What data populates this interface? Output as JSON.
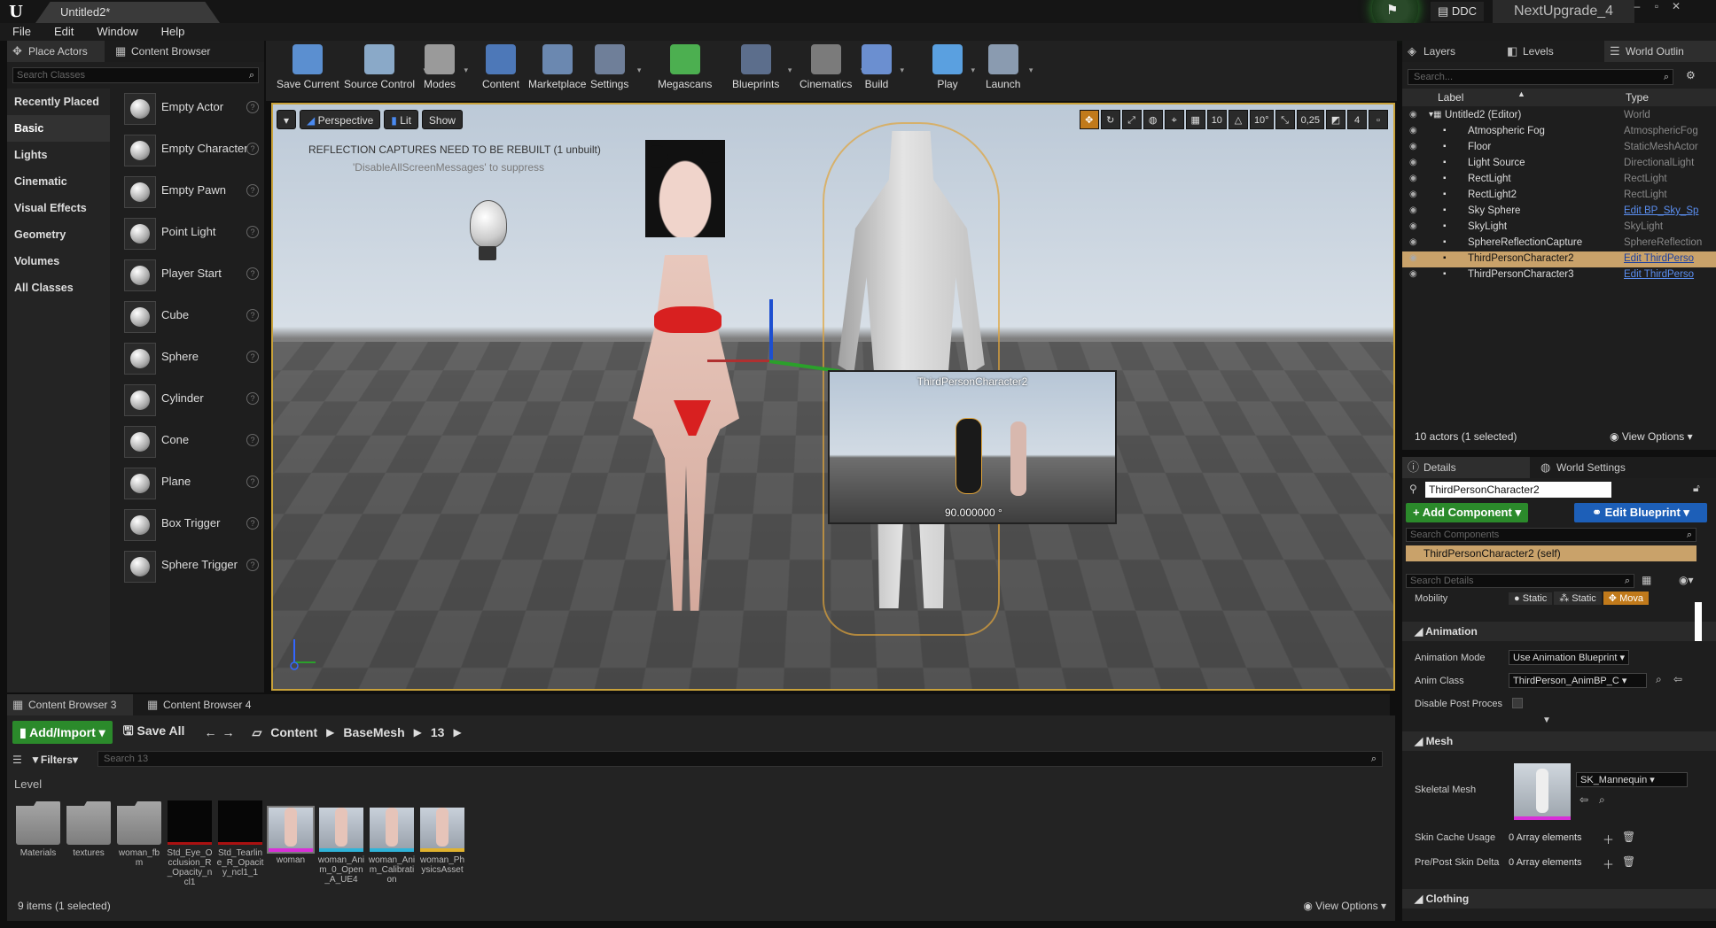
{
  "window": {
    "doc_tab": "Untitled2*",
    "ddc": "DDC",
    "project": "NextUpgrade_4"
  },
  "menu": [
    "File",
    "Edit",
    "Window",
    "Help"
  ],
  "left_tabs": {
    "place_actors": "Place Actors",
    "content_browser": "Content Browser"
  },
  "place_actors": {
    "search_placeholder": "Search Classes",
    "categories": [
      "Recently Placed",
      "Basic",
      "Lights",
      "Cinematic",
      "Visual Effects",
      "Geometry",
      "Volumes",
      "All Classes"
    ],
    "active_category": "Basic",
    "items": [
      "Empty Actor",
      "Empty Character",
      "Empty Pawn",
      "Point Light",
      "Player Start",
      "Cube",
      "Sphere",
      "Cylinder",
      "Cone",
      "Plane",
      "Box Trigger",
      "Sphere Trigger"
    ]
  },
  "toolbar": [
    {
      "label": "Save Current",
      "icon": "save-icon",
      "dd": false
    },
    {
      "label": "Source Control",
      "icon": "source-control-icon",
      "dd": true
    },
    {
      "label": "Modes",
      "icon": "modes-icon",
      "dd": true
    },
    {
      "label": "Content",
      "icon": "content-icon",
      "dd": false
    },
    {
      "label": "Marketplace",
      "icon": "marketplace-icon",
      "dd": false
    },
    {
      "label": "Settings",
      "icon": "settings-icon",
      "dd": true
    },
    {
      "label": "Megascans",
      "icon": "megascans-icon",
      "dd": false
    },
    {
      "label": "Blueprints",
      "icon": "blueprints-icon",
      "dd": true
    },
    {
      "label": "Cinematics",
      "icon": "cinematics-icon",
      "dd": true
    },
    {
      "label": "Build",
      "icon": "build-icon",
      "dd": true
    },
    {
      "label": "Play",
      "icon": "play-icon",
      "dd": true
    },
    {
      "label": "Launch",
      "icon": "launch-icon",
      "dd": true
    }
  ],
  "viewport": {
    "perspective": "Perspective",
    "lit": "Lit",
    "show": "Show",
    "grid_snap": "10",
    "rot_snap": "10°",
    "scale_snap": "0,25",
    "cam_speed": "4",
    "warning": "REFLECTION CAPTURES NEED TO BE REBUILT (1 unbuilt)",
    "warning_hint": "'DisableAllScreenMessages' to suppress",
    "pip_title": "ThirdPersonCharacter2",
    "pip_angle": "90.000000 °"
  },
  "content_browser": {
    "tabs": [
      "Content Browser 3",
      "Content Browser 4"
    ],
    "add_import": "Add/Import",
    "save_all": "Save All",
    "path": [
      "Content",
      "BaseMesh",
      "13"
    ],
    "filters": "Filters",
    "search_placeholder": "Search 13",
    "level_label": "Level",
    "assets": [
      {
        "name": "Materials",
        "kind": "folder"
      },
      {
        "name": "textures",
        "kind": "folder"
      },
      {
        "name": "woman_fbm",
        "kind": "folder"
      },
      {
        "name": "Std_Eye_Occlusion_R_Opacity_ncl1",
        "kind": "tex"
      },
      {
        "name": "Std_Tearline_R_Opacity_ncl1_1",
        "kind": "tex"
      },
      {
        "name": "woman",
        "kind": "mesh"
      },
      {
        "name": "woman_Anim_0_Open_A_UE4",
        "kind": "anim"
      },
      {
        "name": "woman_Anim_Calibration",
        "kind": "anim"
      },
      {
        "name": "woman_PhysicsAsset",
        "kind": "phys"
      }
    ],
    "count": "9 items (1 selected)",
    "view_options": "View Options"
  },
  "outliner": {
    "tabs": [
      "Layers",
      "Levels",
      "World Outlin"
    ],
    "search_placeholder": "Search...",
    "col_label": "Label",
    "col_type": "Type",
    "rows": [
      {
        "label": "Untitled2 (Editor)",
        "type": "World",
        "indent": 0,
        "link": false
      },
      {
        "label": "Atmospheric Fog",
        "type": "AtmosphericFog",
        "indent": 1,
        "link": false
      },
      {
        "label": "Floor",
        "type": "StaticMeshActor",
        "indent": 1,
        "link": false
      },
      {
        "label": "Light Source",
        "type": "DirectionalLight",
        "indent": 1,
        "link": false
      },
      {
        "label": "RectLight",
        "type": "RectLight",
        "indent": 1,
        "link": false
      },
      {
        "label": "RectLight2",
        "type": "RectLight",
        "indent": 1,
        "link": false
      },
      {
        "label": "Sky Sphere",
        "type": "Edit BP_Sky_Sp",
        "indent": 1,
        "link": true
      },
      {
        "label": "SkyLight",
        "type": "SkyLight",
        "indent": 1,
        "link": false
      },
      {
        "label": "SphereReflectionCapture",
        "type": "SphereReflection",
        "indent": 1,
        "link": false
      },
      {
        "label": "ThirdPersonCharacter2",
        "type": "Edit ThirdPerso",
        "indent": 1,
        "link": true,
        "selected": true
      },
      {
        "label": "ThirdPersonCharacter3",
        "type": "Edit ThirdPerso",
        "indent": 1,
        "link": true
      }
    ],
    "footer": "10 actors (1 selected)",
    "view_options": "View Options"
  },
  "details": {
    "tabs": [
      "Details",
      "World Settings"
    ],
    "actor_name": "ThirdPersonCharacter2",
    "add_component": "+ Add Component",
    "edit_blueprint": "Edit Blueprint",
    "search_components": "Search Components",
    "self_row": "ThirdPersonCharacter2 (self)",
    "search_details": "Search Details",
    "mobility_label": "Mobility",
    "mobility_options": [
      "Static",
      "Static",
      "Mova"
    ],
    "sec_animation": "Animation",
    "anim_mode_label": "Animation Mode",
    "anim_mode_value": "Use Animation Blueprint",
    "anim_class_label": "Anim Class",
    "anim_class_value": "ThirdPerson_AnimBP_C",
    "disable_post_label": "Disable Post Proces",
    "sec_mesh": "Mesh",
    "skeletal_mesh_label": "Skeletal Mesh",
    "skeletal_mesh_value": "SK_Mannequin",
    "skin_cache_label": "Skin Cache Usage",
    "skin_cache_value": "0 Array elements",
    "prepost_label": "Pre/Post Skin Delta",
    "prepost_value": "0 Array elements",
    "sec_clothing": "Clothing"
  }
}
